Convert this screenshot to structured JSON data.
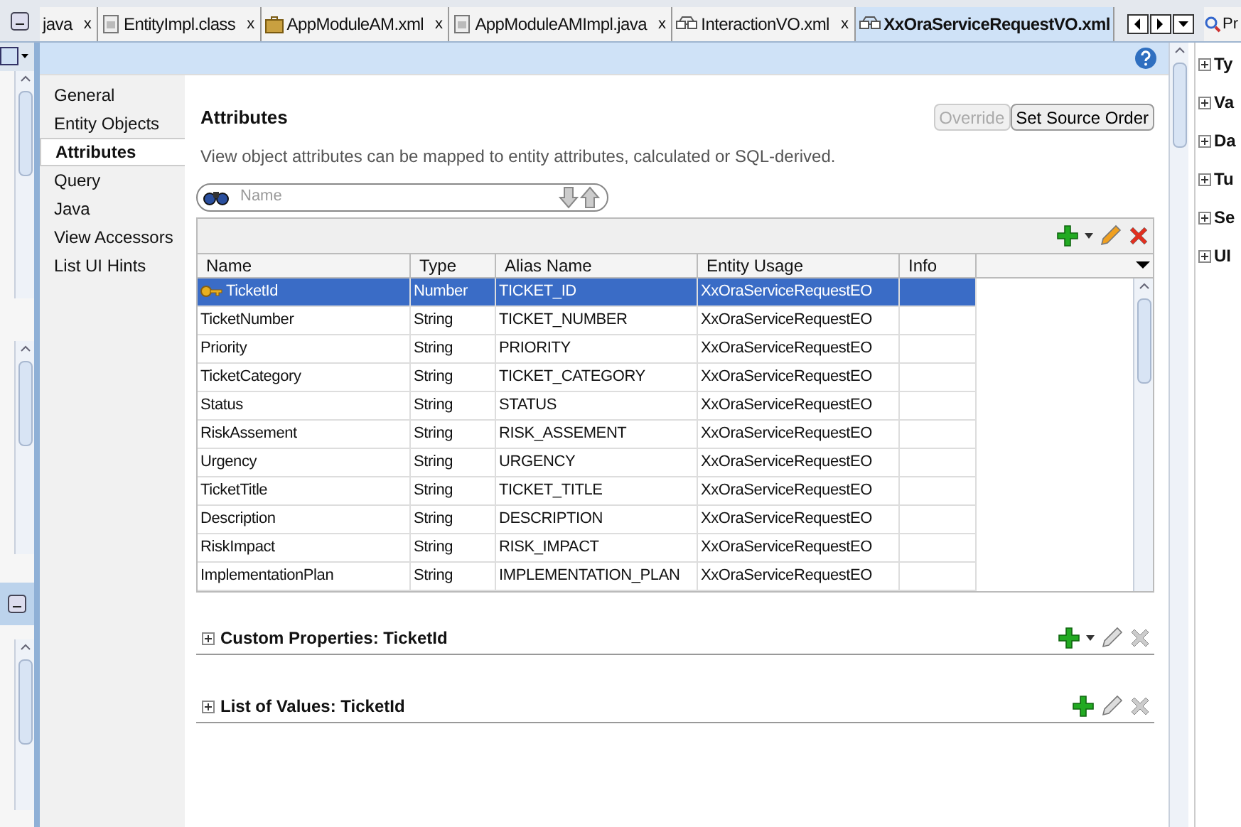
{
  "tabs": [
    {
      "label": "java",
      "kind": "none",
      "selected": false,
      "close": "x"
    },
    {
      "label": "EntityImpl.class",
      "kind": "class",
      "selected": false,
      "close": "x"
    },
    {
      "label": "AppModuleAM.xml",
      "kind": "module",
      "selected": false,
      "close": "x"
    },
    {
      "label": "AppModuleAMImpl.java",
      "kind": "class",
      "selected": false,
      "close": "x"
    },
    {
      "label": "InteractionVO.xml",
      "kind": "view",
      "selected": false,
      "close": "x"
    },
    {
      "label": "XxOraServiceRequestVO.xml",
      "kind": "view",
      "selected": true
    }
  ],
  "right_panel": {
    "tab": "Pr",
    "sections": [
      {
        "label": "Ty",
        "expanded": false
      },
      {
        "label": "Va",
        "expanded": false
      },
      {
        "label": "Da",
        "expanded": false
      },
      {
        "label": "Tu",
        "expanded": false
      },
      {
        "label": "Se",
        "expanded": false
      },
      {
        "label": "UI",
        "expanded": false
      }
    ]
  },
  "nav": [
    {
      "label": "General",
      "selected": false
    },
    {
      "label": "Entity Objects",
      "selected": false
    },
    {
      "label": "Attributes",
      "selected": true
    },
    {
      "label": "Query",
      "selected": false
    },
    {
      "label": "Java",
      "selected": false
    },
    {
      "label": "View Accessors",
      "selected": false
    },
    {
      "label": "List UI Hints",
      "selected": false
    }
  ],
  "title": "Attributes",
  "buttons": [
    {
      "label": "Override",
      "disabled": true
    },
    {
      "label": "Set Source Order",
      "disabled": false
    }
  ],
  "description": "View object attributes can be mapped to entity attributes, calculated or SQL-derived.",
  "search": {
    "placeholder": "Name"
  },
  "table": {
    "columns": [
      "Name",
      "Type",
      "Alias Name",
      "Entity Usage",
      "Info"
    ],
    "rows": [
      {
        "cells": [
          "TicketId",
          "Number",
          "TICKET_ID",
          "XxOraServiceRequestEO",
          ""
        ],
        "key": true,
        "selected": true
      },
      {
        "cells": [
          "TicketNumber",
          "String",
          "TICKET_NUMBER",
          "XxOraServiceRequestEO",
          ""
        ],
        "key": false,
        "selected": false
      },
      {
        "cells": [
          "Priority",
          "String",
          "PRIORITY",
          "XxOraServiceRequestEO",
          ""
        ],
        "key": false,
        "selected": false
      },
      {
        "cells": [
          "TicketCategory",
          "String",
          "TICKET_CATEGORY",
          "XxOraServiceRequestEO",
          ""
        ],
        "key": false,
        "selected": false
      },
      {
        "cells": [
          "Status",
          "String",
          "STATUS",
          "XxOraServiceRequestEO",
          ""
        ],
        "key": false,
        "selected": false
      },
      {
        "cells": [
          "RiskAssement",
          "String",
          "RISK_ASSEMENT",
          "XxOraServiceRequestEO",
          ""
        ],
        "key": false,
        "selected": false
      },
      {
        "cells": [
          "Urgency",
          "String",
          "URGENCY",
          "XxOraServiceRequestEO",
          ""
        ],
        "key": false,
        "selected": false
      },
      {
        "cells": [
          "TicketTitle",
          "String",
          "TICKET_TITLE",
          "XxOraServiceRequestEO",
          ""
        ],
        "key": false,
        "selected": false
      },
      {
        "cells": [
          "Description",
          "String",
          "DESCRIPTION",
          "XxOraServiceRequestEO",
          ""
        ],
        "key": false,
        "selected": false
      },
      {
        "cells": [
          "RiskImpact",
          "String",
          "RISK_IMPACT",
          "XxOraServiceRequestEO",
          ""
        ],
        "key": false,
        "selected": false
      },
      {
        "cells": [
          "ImplementationPlan",
          "String",
          "IMPLEMENTATION_PLAN",
          "XxOraServiceRequestEO",
          ""
        ],
        "key": false,
        "selected": false
      }
    ]
  },
  "sections": [
    {
      "title": "Custom Properties: TicketId",
      "expanded": false,
      "add_menu": true
    },
    {
      "title": "List of Values: TicketId",
      "expanded": false,
      "add_menu": false
    }
  ]
}
